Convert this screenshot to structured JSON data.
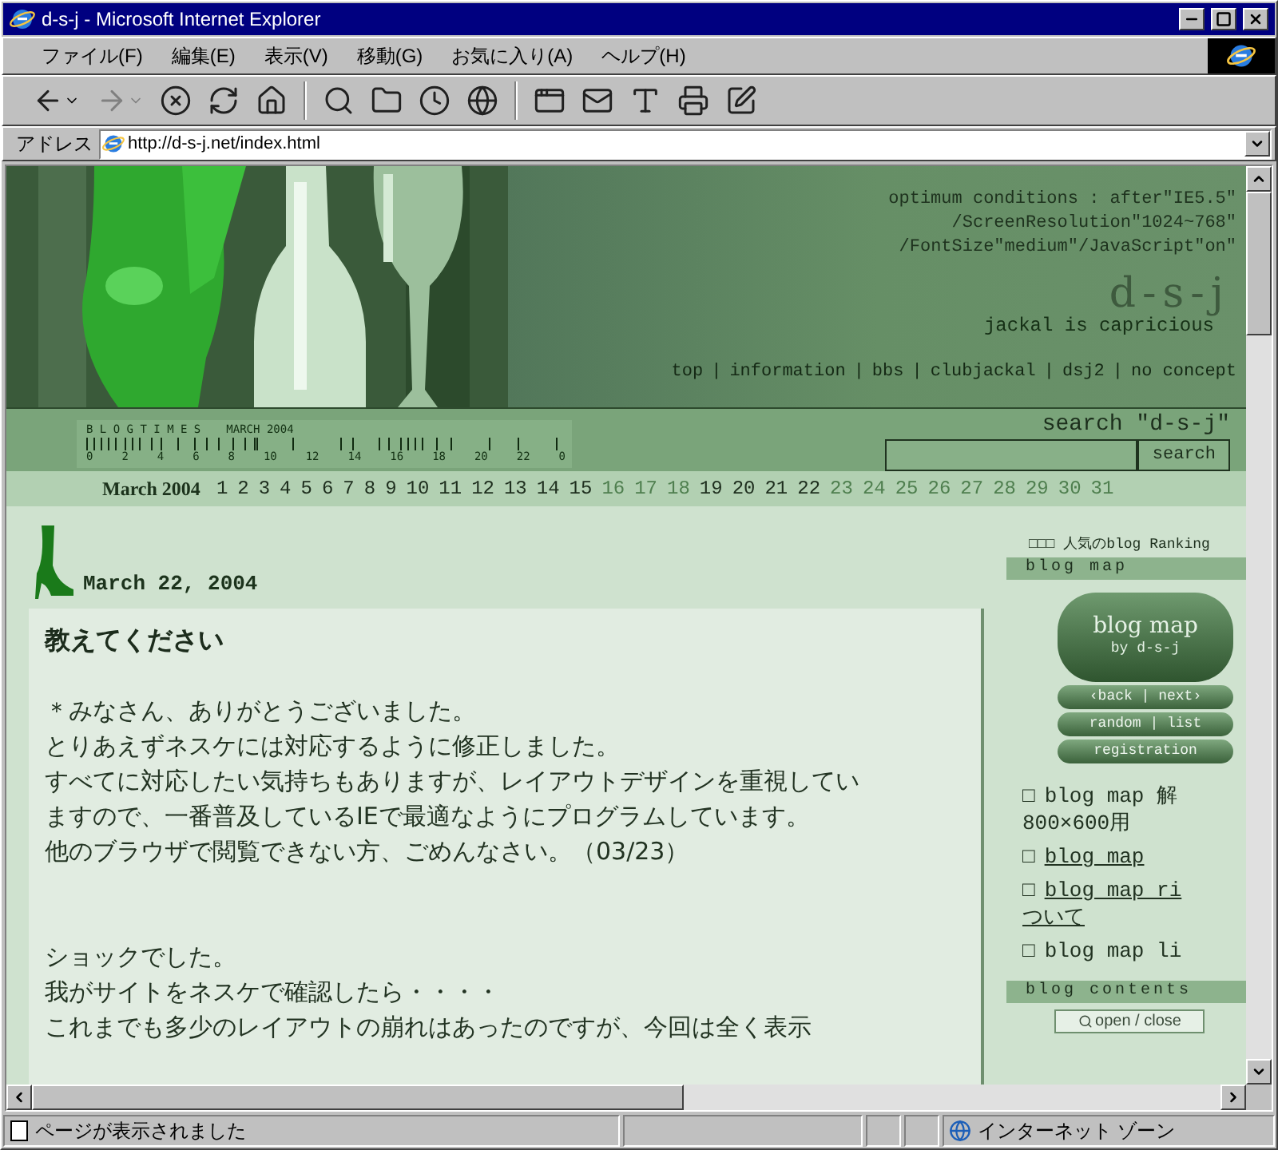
{
  "window": {
    "title": "d-s-j - Microsoft Internet Explorer"
  },
  "menu": [
    "ファイル(F)",
    "編集(E)",
    "表示(V)",
    "移動(G)",
    "お気に入り(A)",
    "ヘルプ(H)"
  ],
  "address": {
    "label": "アドレス",
    "value": "http://d-s-j.net/index.html"
  },
  "header": {
    "conditions": [
      "optimum conditions : after\"IE5.5\"",
      "/ScreenResolution\"1024~768\"",
      "/FontSize\"medium\"/JavaScript\"on\""
    ],
    "logo": "d-s-j",
    "tagline": "jackal is capricious",
    "nav": [
      {
        "label": "top"
      },
      {
        "label": "information"
      },
      {
        "label": "bbs"
      },
      {
        "label": "clubjackal"
      },
      {
        "label": "dsj2"
      },
      {
        "label": "no concept"
      }
    ],
    "separator": "|"
  },
  "blogtimes": {
    "title": "B L O G T I M E S",
    "month": "MARCH 2004",
    "ticks": [
      "0",
      "2",
      "4",
      "6",
      "8",
      "10",
      "12",
      "14",
      "16",
      "18",
      "20",
      "22",
      "0"
    ]
  },
  "search": {
    "label": "search \"d-s-j\"",
    "button": "search"
  },
  "calendar": {
    "label": "March 2004",
    "days": [
      {
        "day": "1",
        "has_entry": true
      },
      {
        "day": "2",
        "has_entry": true
      },
      {
        "day": "3",
        "has_entry": true
      },
      {
        "day": "4",
        "has_entry": true
      },
      {
        "day": "5",
        "has_entry": true
      },
      {
        "day": "6",
        "has_entry": true
      },
      {
        "day": "7",
        "has_entry": true
      },
      {
        "day": "8",
        "has_entry": true
      },
      {
        "day": "9",
        "has_entry": true
      },
      {
        "day": "10",
        "has_entry": true
      },
      {
        "day": "11",
        "has_entry": true
      },
      {
        "day": "12",
        "has_entry": true
      },
      {
        "day": "13",
        "has_entry": true
      },
      {
        "day": "14",
        "has_entry": true
      },
      {
        "day": "15",
        "has_entry": true
      },
      {
        "day": "16",
        "has_entry": false
      },
      {
        "day": "17",
        "has_entry": false
      },
      {
        "day": "18",
        "has_entry": false
      },
      {
        "day": "19",
        "has_entry": true
      },
      {
        "day": "20",
        "has_entry": true
      },
      {
        "day": "21",
        "has_entry": true
      },
      {
        "day": "22",
        "has_entry": true
      },
      {
        "day": "23",
        "has_entry": false
      },
      {
        "day": "24",
        "has_entry": false
      },
      {
        "day": "25",
        "has_entry": false
      },
      {
        "day": "26",
        "has_entry": false
      },
      {
        "day": "27",
        "has_entry": false
      },
      {
        "day": "28",
        "has_entry": false
      },
      {
        "day": "29",
        "has_entry": false
      },
      {
        "day": "30",
        "has_entry": false
      },
      {
        "day": "31",
        "has_entry": false
      }
    ]
  },
  "post": {
    "date": "March 22, 2004",
    "title": "教えてください",
    "paragraphs": [
      [
        "＊みなさん、ありがとうございました。",
        "とりあえずネスケには対応するように修正しました。",
        "すべてに対応したい気持ちもありますが、レイアウトデザインを重視していますので、一番普及しているIEで最適なようにプログラムしています。",
        "他のブラウザで閲覧できない方、ごめんなさい。（03/23）"
      ],
      [
        "ショックでした。",
        "我がサイトをネスケで確認したら・・・・",
        "これまでも多少のレイアウトの崩れはあったのですが、今回は全く表示"
      ]
    ]
  },
  "sidebar": {
    "ranking": "□□□ 人気のblog Ranking",
    "blog_map_heading": "blog map",
    "map_banner": {
      "title": "blog map",
      "subtitle": "by d-s-j",
      "buttons": [
        "‹back | next›",
        "random | list",
        "registration"
      ]
    },
    "items": [
      {
        "mark": "□",
        "lines": [
          "blog map 解",
          "800×600用"
        ],
        "link": false
      },
      {
        "mark": "□",
        "lines": [
          "blog map"
        ],
        "link": true
      },
      {
        "mark": "□",
        "lines": [
          "blog map ri",
          "ついて"
        ],
        "link": true
      },
      {
        "mark": "□",
        "lines": [
          "blog map li"
        ],
        "link": false
      }
    ],
    "contents_heading": "blog contents",
    "toggle": "open / close"
  },
  "status": {
    "text": "ページが表示されました",
    "zone": "インターネット ゾーン"
  }
}
